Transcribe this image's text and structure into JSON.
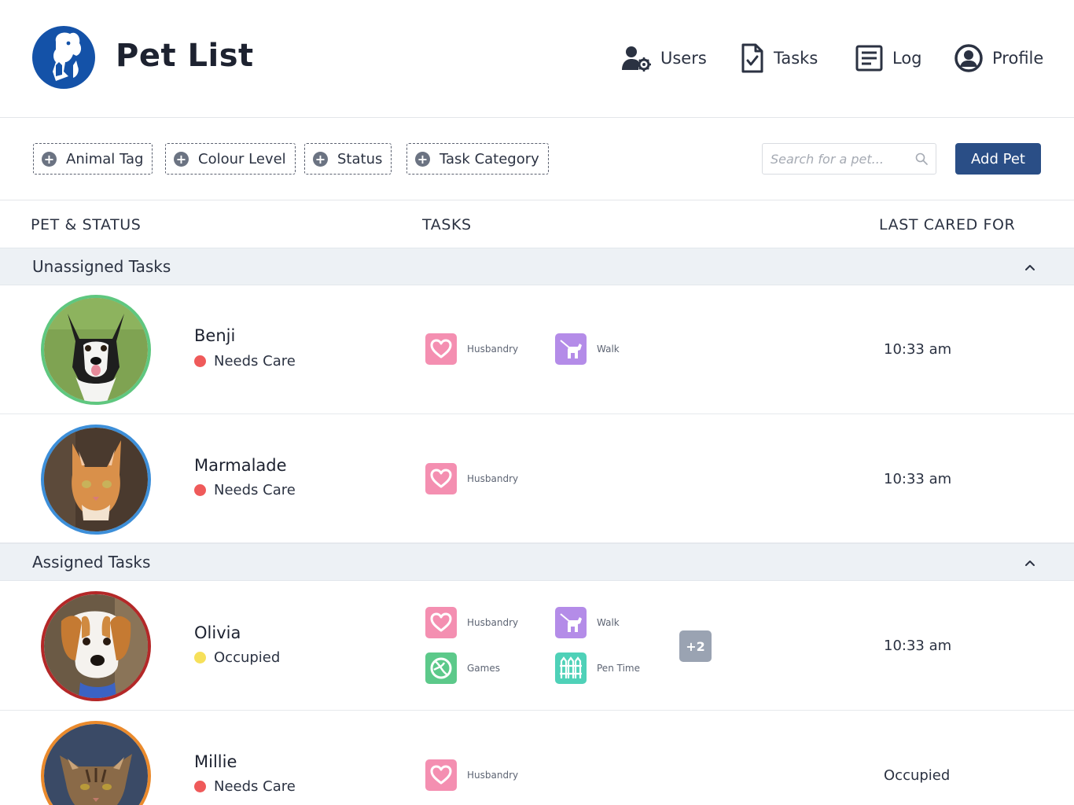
{
  "header": {
    "title": "Pet List",
    "nav": [
      {
        "label": "Users",
        "icon": "users-gear-icon"
      },
      {
        "label": "Tasks",
        "icon": "document-check-icon"
      },
      {
        "label": "Log",
        "icon": "list-document-icon"
      },
      {
        "label": "Profile",
        "icon": "user-circle-icon"
      }
    ]
  },
  "filters": {
    "chips": [
      "Animal Tag",
      "Colour Level",
      "Status",
      "Task Category"
    ],
    "search_placeholder": "Search for a pet...",
    "add_button": "Add Pet"
  },
  "columns": {
    "pet_status": "PET & STATUS",
    "tasks": "TASKS",
    "last_cared": "LAST CARED FOR"
  },
  "sections": [
    {
      "title": "Unassigned Tasks",
      "expanded": true,
      "pets": [
        {
          "name": "Benji",
          "status": "Needs Care",
          "status_color": "#ef5a5a",
          "ring_color": "#5fc77f",
          "photo": "husky-photo",
          "tasks": [
            "Husbandry",
            "Walk"
          ],
          "more": "",
          "last_cared": "10:33 am"
        },
        {
          "name": "Marmalade",
          "status": "Needs Care",
          "status_color": "#ef5a5a",
          "ring_color": "#3d8fd9",
          "photo": "orange-cat-photo",
          "tasks": [
            "Husbandry"
          ],
          "more": "",
          "last_cared": "10:33 am"
        }
      ]
    },
    {
      "title": "Assigned Tasks",
      "expanded": true,
      "pets": [
        {
          "name": "Olivia",
          "status": "Occupied",
          "status_color": "#f6e05a",
          "ring_color": "#b42828",
          "photo": "beagle-photo",
          "tasks": [
            "Husbandry",
            "Walk",
            "Games",
            "Pen Time"
          ],
          "more": "+2",
          "last_cared": "10:33 am"
        },
        {
          "name": "Millie",
          "status": "Needs Care",
          "status_color": "#ef5a5a",
          "ring_color": "#ea8a2c",
          "photo": "tabby-cat-photo",
          "tasks": [
            "Husbandry"
          ],
          "more": "",
          "last_cared": "Occupied"
        }
      ]
    }
  ],
  "task_colors": {
    "Husbandry": "#f48fb1",
    "Walk": "#b48ce8",
    "Games": "#5cc98a",
    "Pen Time": "#4fd1b8"
  }
}
